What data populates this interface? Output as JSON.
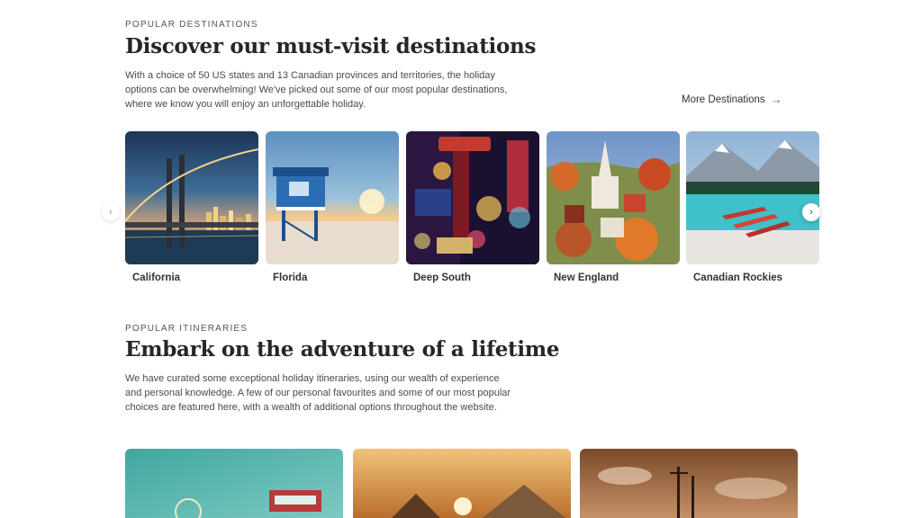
{
  "destinations_section": {
    "eyebrow": "POPULAR DESTINATIONS",
    "heading": "Discover our must-visit destinations",
    "description": "With a choice of 50 US states and 13 Canadian provinces and territories, the holiday options can be overwhelming! We've picked out some of our most popular destinations, where we know you will enjoy an unforgettable holiday.",
    "more_link": "More Destinations",
    "cards": [
      {
        "label": "California"
      },
      {
        "label": "Florida"
      },
      {
        "label": "Deep South"
      },
      {
        "label": "New England"
      },
      {
        "label": "Canadian Rockies"
      }
    ]
  },
  "itineraries_section": {
    "eyebrow": "POPULAR ITINERARIES",
    "heading": "Embark on the adventure of a lifetime",
    "description": "We have curated some exceptional holiday itineraries, using our wealth of experience and personal knowledge. A few of our personal favourites and some of our most popular choices are featured here, with a wealth of additional options throughout the website."
  },
  "icons": {
    "more_arrow": "arrow-right-icon",
    "prev": "chevron-left-icon",
    "next": "chevron-right-icon"
  },
  "colors": {
    "accent": "#2e8b7a",
    "heading": "#2a2522"
  }
}
